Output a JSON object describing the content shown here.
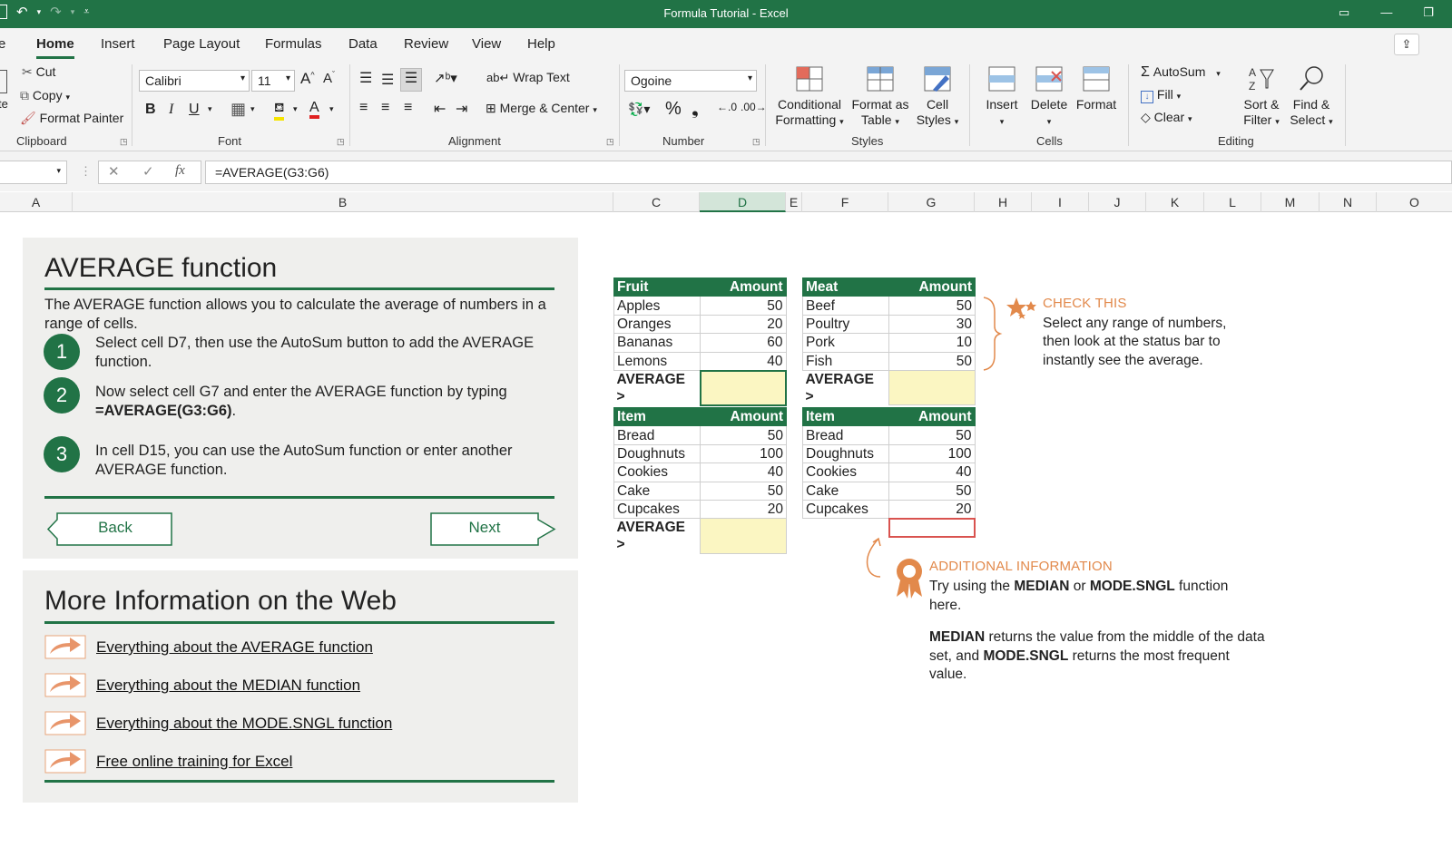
{
  "window": {
    "title": "Formula Tutorial  -  Excel"
  },
  "tabs": [
    "Home",
    "Insert",
    "Page Layout",
    "Formulas",
    "Data",
    "Review",
    "View",
    "Help"
  ],
  "ribbon": {
    "clipboard": {
      "cut": "Cut",
      "copy": "Copy",
      "format_painter": "Format Painter",
      "label": "Clipboard"
    },
    "font": {
      "font_name": "Calibri",
      "font_size": "11",
      "label": "Font",
      "bold": "B",
      "italic": "I",
      "underline": "U"
    },
    "alignment": {
      "wrap_text": "Wrap Text",
      "merge_center": "Merge & Center",
      "label": "Alignment"
    },
    "number": {
      "format": "Ogoine",
      "label": "Number"
    },
    "styles": {
      "conditional_1": "Conditional",
      "conditional_2": "Formatting",
      "format_table_1": "Format as",
      "format_table_2": "Table",
      "cell_styles_1": "Cell",
      "cell_styles_2": "Styles",
      "label": "Styles"
    },
    "cells": {
      "insert": "Insert",
      "delete": "Delete",
      "format": "Format",
      "label": "Cells"
    },
    "editing": {
      "autosum": "AutoSum",
      "fill": "Fill",
      "clear": "Clear",
      "sort_1": "Sort &",
      "sort_2": "Filter",
      "find_1": "Find &",
      "find_2": "Select",
      "label": "Editing"
    }
  },
  "formula_bar": {
    "formula": "=AVERAGE(G3:G6)",
    "fx": "fx"
  },
  "columns": [
    "A",
    "B",
    "C",
    "D",
    "E",
    "F",
    "G",
    "H",
    "I",
    "J",
    "K",
    "L",
    "M",
    "N",
    "O"
  ],
  "tutorial": {
    "title": "AVERAGE function",
    "intro": "The AVERAGE function allows you to calculate the average of numbers in a range of cells.",
    "steps": [
      {
        "num": "1",
        "text": "Select cell D7, then use the AutoSum button to add the AVERAGE function."
      },
      {
        "num": "2",
        "text": "Now select cell G7 and enter the AVERAGE function by typing",
        "bold": "=AVERAGE(G3:G6)",
        "tail": "."
      },
      {
        "num": "3",
        "text": "In cell D15, you can use the AutoSum function or enter another AVERAGE function."
      }
    ],
    "back": "Back",
    "next": "Next"
  },
  "more_info": {
    "title": "More Information on the Web",
    "links": [
      "Everything about the AVERAGE function",
      "Everything about the MEDIAN function",
      "Everything about the MODE.SNGL function",
      "Free online training for Excel"
    ]
  },
  "tables": {
    "fruit": {
      "h1": "Fruit",
      "h2": "Amount",
      "rows": [
        [
          "Apples",
          "50"
        ],
        [
          "Oranges",
          "20"
        ],
        [
          "Bananas",
          "60"
        ],
        [
          "Lemons",
          "40"
        ]
      ],
      "avg_label": "AVERAGE >"
    },
    "meat": {
      "h1": "Meat",
      "h2": "Amount",
      "rows": [
        [
          "Beef",
          "50"
        ],
        [
          "Poultry",
          "30"
        ],
        [
          "Pork",
          "10"
        ],
        [
          "Fish",
          "50"
        ]
      ],
      "avg_label": "AVERAGE >"
    },
    "item1": {
      "h1": "Item",
      "h2": "Amount",
      "rows": [
        [
          "Bread",
          "50"
        ],
        [
          "Doughnuts",
          "100"
        ],
        [
          "Cookies",
          "40"
        ],
        [
          "Cake",
          "50"
        ],
        [
          "Cupcakes",
          "20"
        ]
      ],
      "avg_label": "AVERAGE >"
    },
    "item2": {
      "h1": "Item",
      "h2": "Amount",
      "rows": [
        [
          "Bread",
          "50"
        ],
        [
          "Doughnuts",
          "100"
        ],
        [
          "Cookies",
          "40"
        ],
        [
          "Cake",
          "50"
        ],
        [
          "Cupcakes",
          "20"
        ]
      ]
    }
  },
  "check_this": {
    "heading": "CHECK THIS",
    "lines": [
      "Select any range of numbers,",
      "then look at the status bar to",
      "instantly see the average."
    ]
  },
  "additional": {
    "heading": "ADDITIONAL INFORMATION",
    "p1_a": "Try using the ",
    "p1_b": "MEDIAN",
    "p1_c": " or ",
    "p1_d": "MODE.SNGL",
    "p1_e": " function",
    "p1_f": "here.",
    "p2_a": "MEDIAN",
    "p2_b": " returns the value from the middle of the data",
    "p2_c": "set, and ",
    "p2_d": "MODE.SNGL",
    "p2_e": " returns the most frequent",
    "p2_f": "value."
  },
  "colors": {
    "accent": "#217346",
    "orange": "#e2894b",
    "highlight": "#fbf6c2"
  }
}
